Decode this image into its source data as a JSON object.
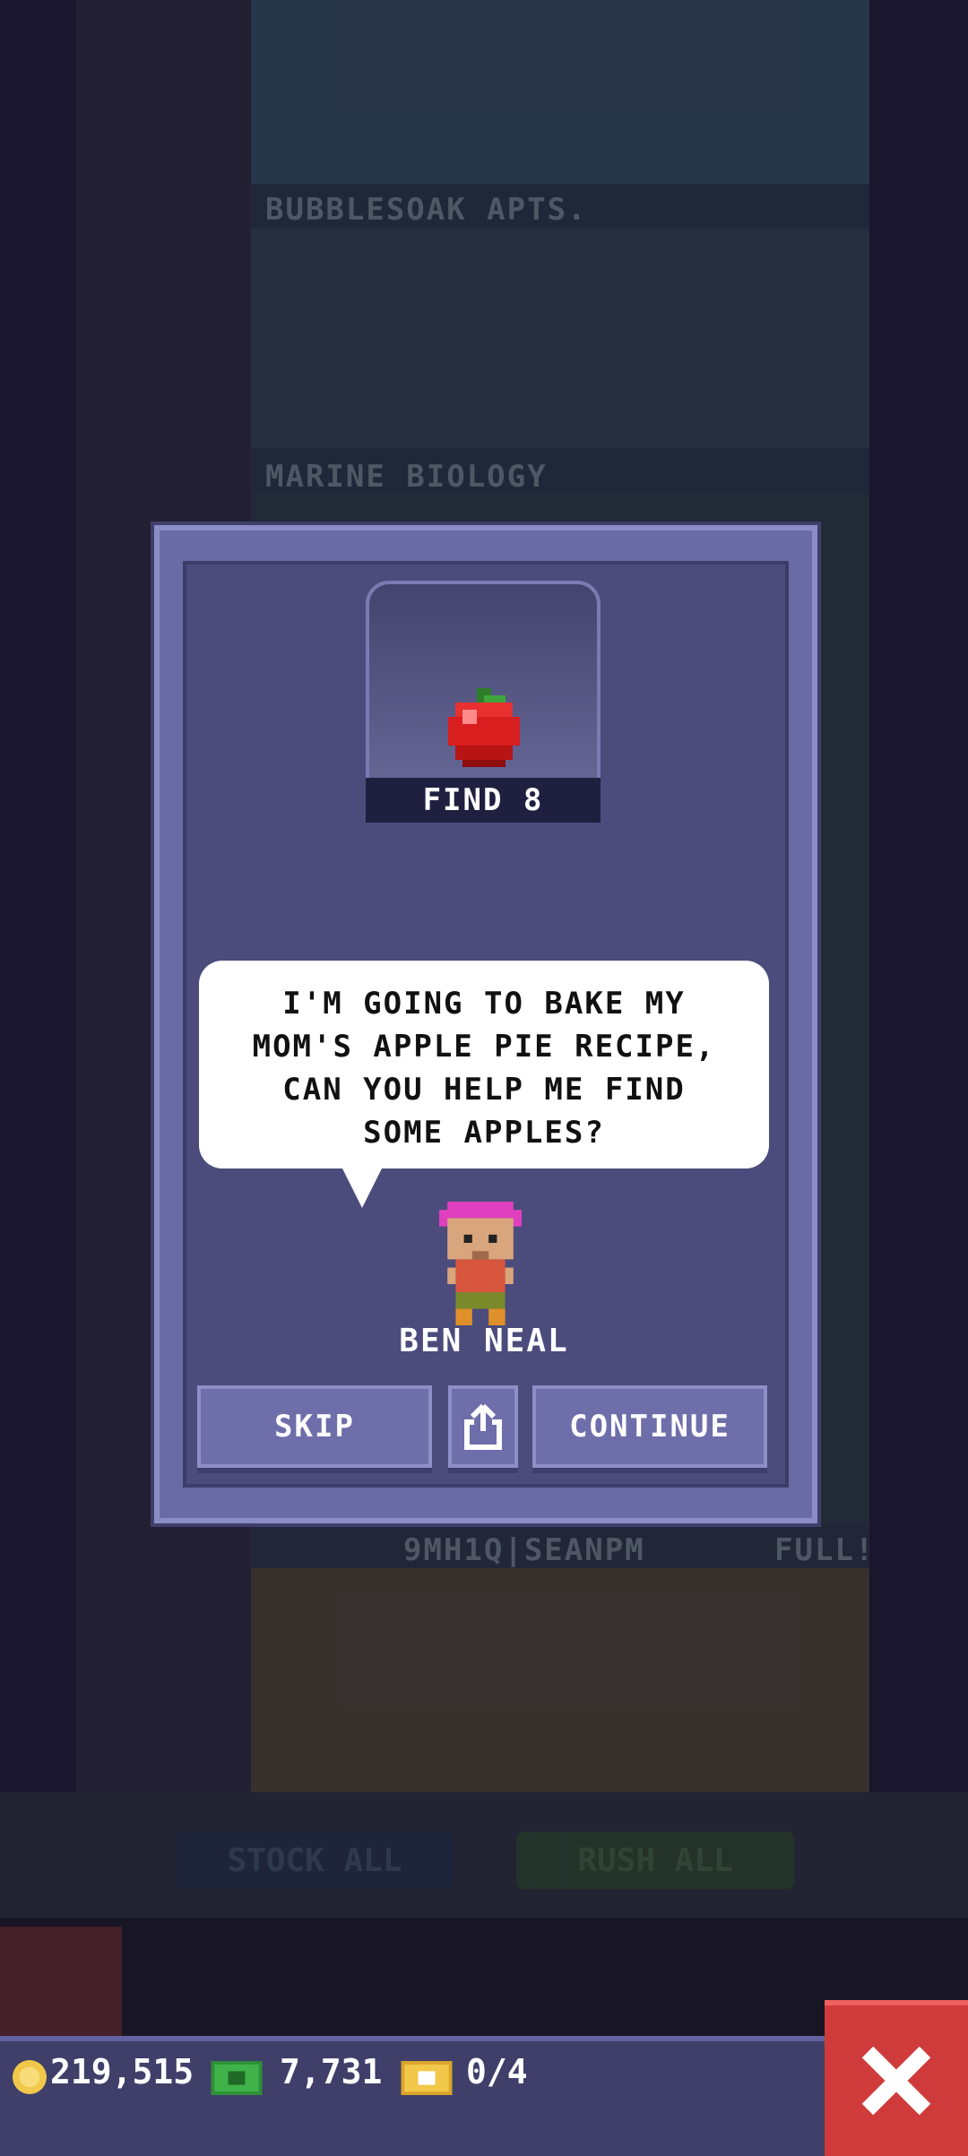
{
  "tower": {
    "floor_labels": [
      "BUBBLESOAK APTS.",
      "MARINE BIOLOGY",
      "9MH1Q|SEANPM"
    ],
    "floor_status": "FULL!"
  },
  "actions": {
    "stock_all_label": "STOCK ALL",
    "rush_all_label": "RUSH ALL"
  },
  "dialog": {
    "item_label": "FIND 8",
    "item_icon": "apple-icon",
    "speech_lines": [
      "I'M GOING TO BAKE MY",
      "MOM'S APPLE PIE RECIPE,",
      "CAN YOU HELP ME FIND",
      "SOME APPLES?"
    ],
    "character_name": "BEN NEAL",
    "skip_label": "SKIP",
    "continue_label": "CONTINUE",
    "share_icon": "share-icon"
  },
  "status_bar": {
    "coins": "219,515",
    "bux": "7,731",
    "tickets": "0/4",
    "colors": {
      "coin": "#f2c84b",
      "bux": "#3fb34a",
      "ticket": "#f2c84b",
      "close": "#cf3b3b"
    }
  }
}
